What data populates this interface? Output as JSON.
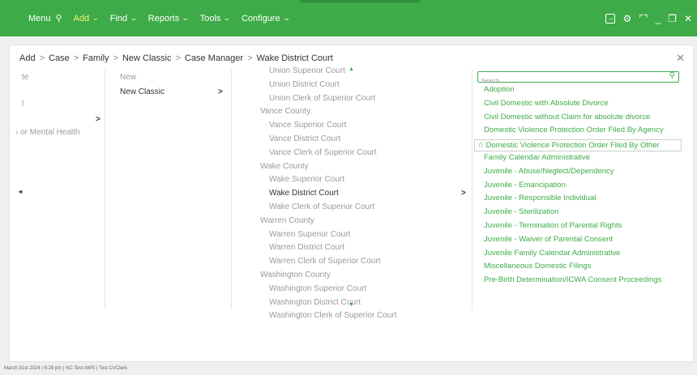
{
  "nav": {
    "menu_label": "Menu",
    "add_label": "Add",
    "find_label": "Find",
    "reports_label": "Reports",
    "tools_label": "Tools",
    "configure_label": "Configure"
  },
  "breadcrumb": {
    "items": [
      "Add",
      "Case",
      "Family",
      "New Classic",
      "Case Manager",
      "Wake District Court"
    ],
    "separator": ">"
  },
  "column1": {
    "items": [
      "te",
      "l",
      "› or Mental Health"
    ],
    "arrow": ">",
    "left_arrow": "◂"
  },
  "column2": {
    "items": [
      "New",
      "New Classic"
    ],
    "arrow": ">"
  },
  "column3": {
    "groups": [
      {
        "county": "",
        "courts": [
          "Union Superior Court",
          "Union District Court",
          "Union Clerk of Superior Court"
        ]
      },
      {
        "county": "Vance County",
        "courts": [
          "Vance Superior Court",
          "Vance District Court",
          "Vance Clerk of Superior Court"
        ]
      },
      {
        "county": "Wake County",
        "courts": [
          "Wake Superior Court",
          "Wake District Court",
          "Wake Clerk of Superior Court"
        ]
      },
      {
        "county": "Warren County",
        "courts": [
          "Warren Superior Court",
          "Warren District Court",
          "Warren Clerk of Superior Court"
        ]
      },
      {
        "county": "Washington County",
        "courts": [
          "Washington Superior Court",
          "Washington District Court",
          "Washington Clerk of Superior Court"
        ]
      }
    ],
    "selected": "Wake District Court",
    "arrow": ">"
  },
  "column4": {
    "search_placeholder": "Search...",
    "case_types": [
      "Adoption",
      "Civil Domestic with Absolute Divorce",
      "Civil Domestic without Claim for absolute divorce",
      "Domestic Violence Protection Order Filed By Agency",
      "Domestic Violence Protection Order Filed By Other",
      "Family Calendar Administrative",
      "Juvenile - Abuse/Neglect/Dependency",
      "Juvenile - Emancipation",
      "Juvenile - Responsible Individual",
      "Juvenile - Sterilization",
      "Juvenile - Termination of Parental Rights",
      "Juvenile - Waiver of Parental Consent",
      "Juvenile Family Calendar Administrative",
      "Miscellaneous Domestic Filings",
      "Pre-Birth Determination/ICWA Consent Proceedings"
    ],
    "highlighted_index": 4
  },
  "status_bar": {
    "text": "March 31st 2024  |  6:28 pm  |  NC Test AWS  |  Test CVClerk"
  },
  "colors": {
    "brand_green": "#3dab48",
    "active_nav": "#fff36b"
  }
}
